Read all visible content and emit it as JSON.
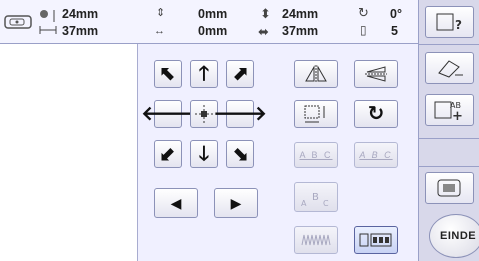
{
  "info": {
    "height_value": "24mm",
    "width_value": "37mm",
    "pos_x_value": "0mm",
    "pos_y_value": "0mm",
    "size_h_value": "24mm",
    "size_w_value": "37mm",
    "rotation_value": "0°",
    "color_count_value": "5"
  },
  "buttons": {
    "end_label": "EINDE",
    "array_label_abc": "A B C",
    "array_label_abc2": "A B C"
  },
  "colors": {
    "accent": "#8c92b8",
    "panel_bg": "#f0f0ff",
    "right_bg": "#d8d8ea"
  }
}
